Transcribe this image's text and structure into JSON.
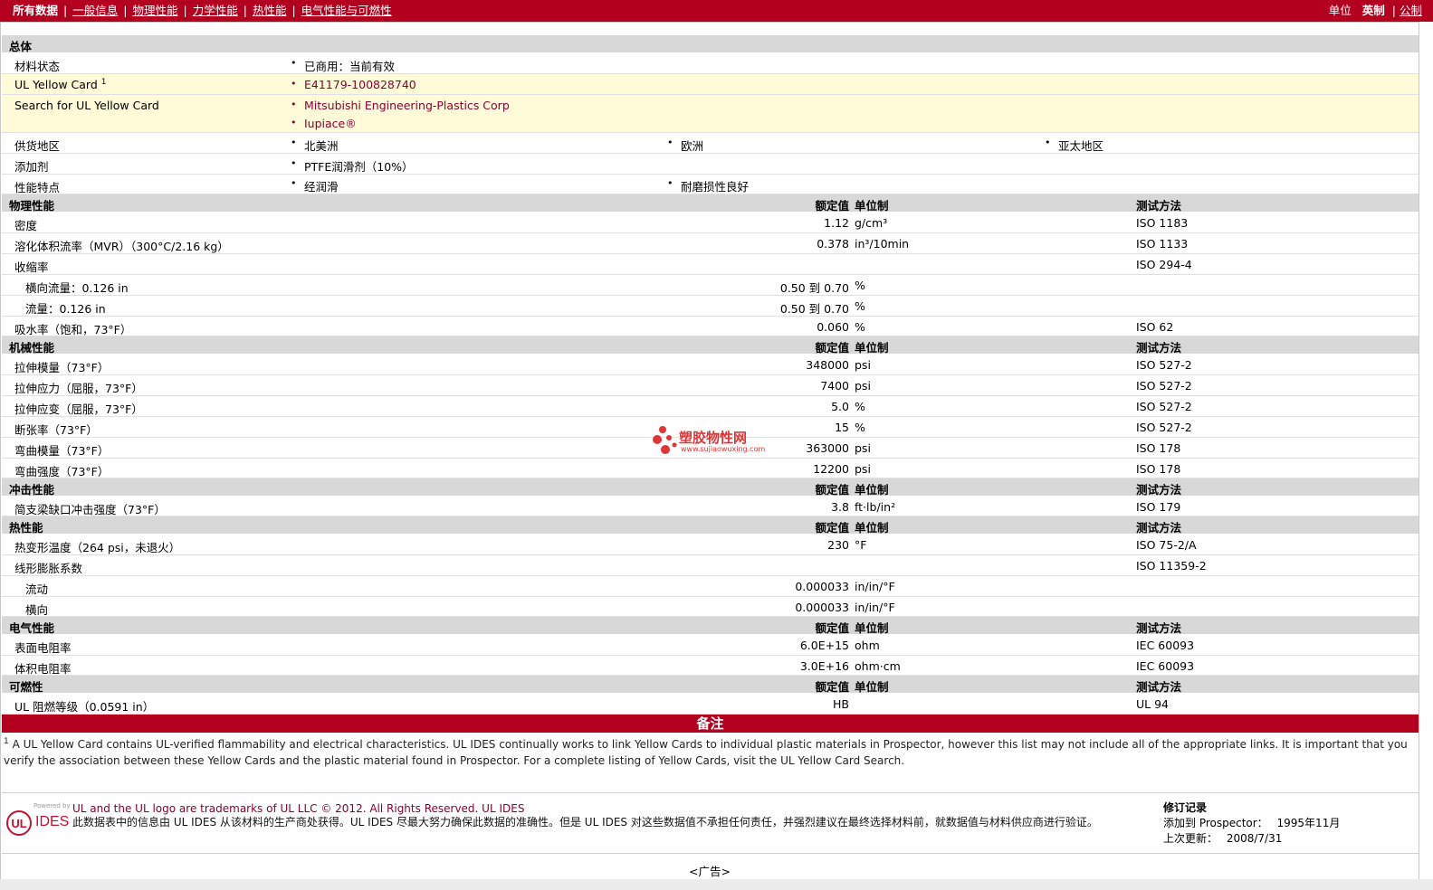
{
  "topbar": {
    "nav": [
      "所有数据",
      "一般信息",
      "物理性能",
      "力学性能",
      "热性能",
      "电气性能与可燃性"
    ],
    "units_label": "单位",
    "unit_selected": "英制",
    "unit_other": "公制"
  },
  "headers": {
    "rated": "额定值",
    "unit": "单位制",
    "method": "测试方法"
  },
  "general": {
    "title": "总体",
    "status_label": "材料状态",
    "status_value": "已商用：当前有效",
    "ulcard_label": "UL Yellow Card",
    "ulcard_sup": "1",
    "ulcard_value": "E41179-100828740",
    "search_label": "Search for UL Yellow Card",
    "search_values": [
      "Mitsubishi Engineering-Plastics Corp",
      "Iupiace®"
    ],
    "supply_label": "供货地区",
    "supply_values": [
      "北美洲",
      "欧洲",
      "亚太地区"
    ],
    "additive_label": "添加剂",
    "additive_value": "PTFE润滑剂（10%）",
    "feature_label": "性能特点",
    "feature_values": [
      "经润滑",
      "耐磨损性良好"
    ]
  },
  "physical": {
    "title": "物理性能",
    "rows": [
      {
        "label": "密度",
        "value": "1.12",
        "unit": "g/cm³",
        "method": "ISO 1183"
      },
      {
        "label": "溶化体积流率（MVR）（300°C/2.16 kg）",
        "value": "0.378",
        "unit": "in³/10min",
        "method": "ISO 1133"
      },
      {
        "label": "收缩率",
        "value": "",
        "unit": "",
        "method": "ISO 294-4"
      },
      {
        "label": "横向流量：0.126 in",
        "value": "0.50 到  0.70",
        "unit": "%",
        "method": ""
      },
      {
        "label": "流量：0.126 in",
        "value": "0.50 到  0.70",
        "unit": "%",
        "method": ""
      },
      {
        "label": "吸水率（饱和，73°F）",
        "value": "0.060",
        "unit": "%",
        "method": "ISO 62"
      }
    ]
  },
  "mechanical": {
    "title": "机械性能",
    "rows": [
      {
        "label": "拉伸模量（73°F）",
        "value": "348000",
        "unit": "psi",
        "method": "ISO 527-2"
      },
      {
        "label": "拉伸应力（屈服，73°F）",
        "value": "7400",
        "unit": "psi",
        "method": "ISO 527-2"
      },
      {
        "label": "拉伸应变（屈服，73°F）",
        "value": "5.0",
        "unit": "%",
        "method": "ISO 527-2"
      },
      {
        "label": "断张率（73°F）",
        "value": "15",
        "unit": "%",
        "method": "ISO 527-2"
      },
      {
        "label": "弯曲模量（73°F）",
        "value": "363000",
        "unit": "psi",
        "method": "ISO 178"
      },
      {
        "label": "弯曲强度（73°F）",
        "value": "12200",
        "unit": "psi",
        "method": "ISO 178"
      }
    ]
  },
  "impact": {
    "title": "冲击性能",
    "rows": [
      {
        "label": "简支梁缺口冲击强度（73°F）",
        "value": "3.8",
        "unit": "ft·lb/in²",
        "method": "ISO 179"
      }
    ]
  },
  "thermal": {
    "title": "热性能",
    "rows": [
      {
        "label": "热变形温度（264 psi，未退火）",
        "value": "230",
        "unit": "°F",
        "method": "ISO 75-2/A"
      },
      {
        "label": "线形膨胀系数",
        "value": "",
        "unit": "",
        "method": "ISO 11359-2"
      },
      {
        "label": "流动",
        "value": "0.000033",
        "unit": "in/in/°F",
        "method": ""
      },
      {
        "label": "横向",
        "value": "0.000033",
        "unit": "in/in/°F",
        "method": ""
      }
    ]
  },
  "electrical": {
    "title": "电气性能",
    "rows": [
      {
        "label": "表面电阻率",
        "value": "6.0E+15",
        "unit": "ohm",
        "method": "IEC 60093"
      },
      {
        "label": "体积电阻率",
        "value": "3.0E+16",
        "unit": "ohm·cm",
        "method": "IEC 60093"
      }
    ]
  },
  "flammability": {
    "title": "可燃性",
    "rows": [
      {
        "label": "UL 阻燃等级（0.0591 in）",
        "value": "HB",
        "unit": "",
        "method": "UL 94"
      }
    ]
  },
  "notes": {
    "title": "备注",
    "sup": "1",
    "text": "A UL Yellow Card contains UL-verified flammability and electrical characteristics. UL IDES continually works to link Yellow Cards to individual plastic materials in Prospector, however this list may not include all of the appropriate links. It is important that you verify the association between these Yellow Cards and the plastic material found in Prospector. For a complete listing of Yellow Cards, visit the UL Yellow Card Search."
  },
  "footer": {
    "logo_powered": "Powered by",
    "logo_text": "IDES",
    "trademark": "UL and the UL logo are trademarks of UL LLC © 2012. All Rights Reserved. UL IDES",
    "disclaimer": "此数据表中的信息由  UL IDES 从该材料的生产商处获得。UL IDES 尽最大努力确保此数据的准确性。但是  UL IDES 对这些数据值不承担任何责任，并强烈建议在最终选择材料前，就数据值与材料供应商进行验证。",
    "rev_title": "修订记录",
    "added_label": "添加到  Prospector：",
    "added_value": "1995年11月",
    "updated_label": "上次更新：",
    "updated_value": "2008/7/31"
  },
  "ad": "<广告>",
  "watermark": {
    "cn": "塑胶物性网",
    "url": "www.sujiaowuxing.com"
  },
  "colors": {
    "brand": "#b2001e",
    "section": "#d8d8d8",
    "highlight": "#fffbd8",
    "link": "#8b0030"
  }
}
